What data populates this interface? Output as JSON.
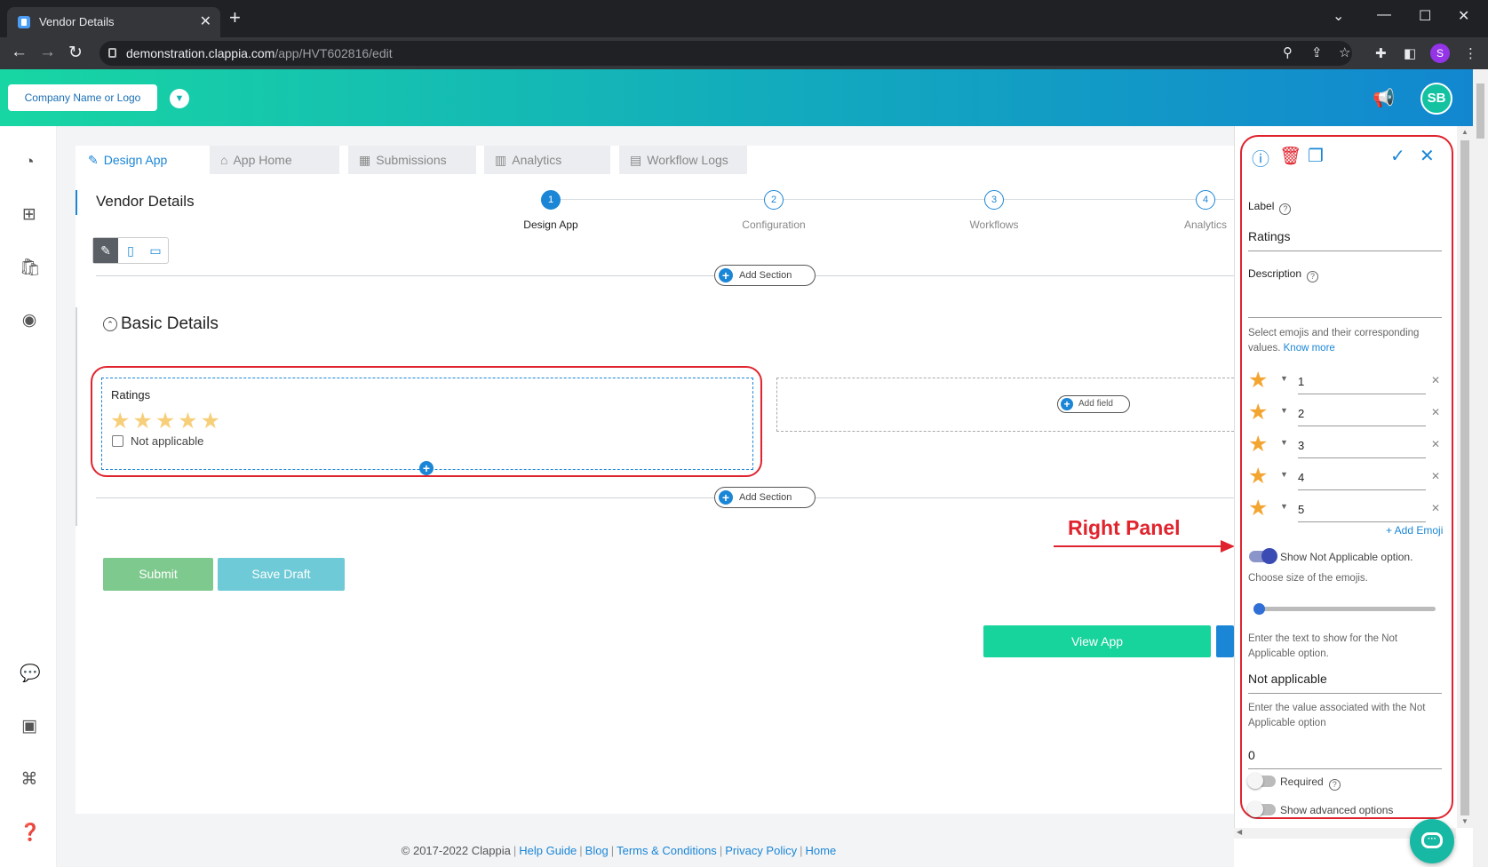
{
  "browser": {
    "tab_title": "Vendor Details",
    "url_host": "demonstration.clappia.com",
    "url_path": "/app/HVT602816/edit",
    "profile_initial": "S"
  },
  "header": {
    "company_label": "Company Name or Logo",
    "user_initials": "SB"
  },
  "tabs": [
    {
      "label": "Design App",
      "icon": "edit-icon"
    },
    {
      "label": "App Home",
      "icon": "home-icon"
    },
    {
      "label": "Submissions",
      "icon": "table-icon"
    },
    {
      "label": "Analytics",
      "icon": "bar-chart-icon"
    },
    {
      "label": "Workflow Logs",
      "icon": "list-icon"
    }
  ],
  "app_name": "Vendor Details",
  "steps": [
    {
      "number": "1",
      "label": "Design App"
    },
    {
      "number": "2",
      "label": "Configuration"
    },
    {
      "number": "3",
      "label": "Workflows"
    },
    {
      "number": "4",
      "label": "Analytics"
    }
  ],
  "add_section_label": "Add Section",
  "section_title": "Basic Details",
  "rating_field": {
    "label": "Ratings",
    "stars": "★★★★★",
    "not_applicable": "Not applicable"
  },
  "add_field_label": "Add field",
  "buttons": {
    "submit": "Submit",
    "save_draft": "Save Draft",
    "view_app": "View App"
  },
  "annotation": {
    "text": "Right Panel"
  },
  "right_panel": {
    "label_title": "Label",
    "label_value": "Ratings",
    "description_title": "Description",
    "emoji_help": "Select emojis and their corresponding values.",
    "know_more": "Know more",
    "emojis": [
      {
        "icon": "star-icon",
        "value": "1"
      },
      {
        "icon": "star-icon",
        "value": "2"
      },
      {
        "icon": "star-icon",
        "value": "3"
      },
      {
        "icon": "star-icon",
        "value": "4"
      },
      {
        "icon": "star-icon",
        "value": "5"
      }
    ],
    "add_emoji": "+ Add Emoji",
    "show_na_label": "Show Not Applicable option.",
    "show_na_on": true,
    "size_label": "Choose size of the emojis.",
    "size_level": 0,
    "na_text_help": "Enter the text to show for the Not Applicable option.",
    "na_text_value": "Not applicable",
    "na_value_help": "Enter the value associated with the Not Applicable option",
    "na_value": "0",
    "required_label": "Required",
    "advanced_label": "Show advanced options"
  },
  "footer": {
    "copyright": "© 2017-2022 Clappia",
    "links": [
      "Help Guide",
      "Blog",
      "Terms & Conditions",
      "Privacy Policy",
      "Home"
    ]
  },
  "colors": {
    "accent": "#1b86d6",
    "annotation_red": "#e0242e",
    "star": "#f3a531",
    "view_app": "#17d39c"
  }
}
